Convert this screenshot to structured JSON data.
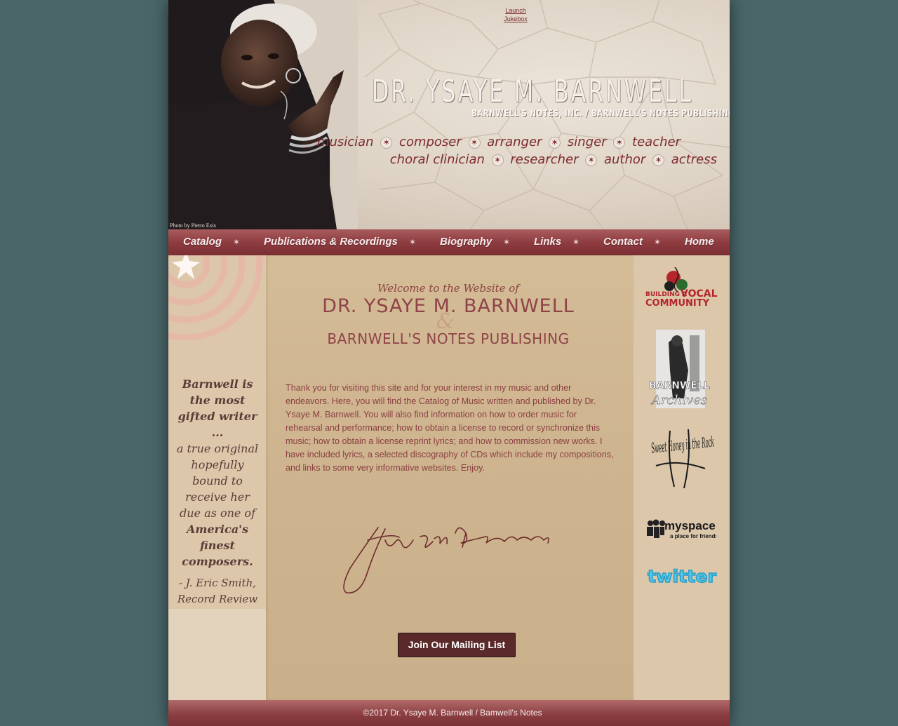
{
  "header": {
    "jukebox_line1": "Launch",
    "jukebox_line2": "Jukebox",
    "title": "DR. YSAYE M. BARNWELL",
    "subtitle": "BARNWELL'S NOTES, INC. / BARNWELL'S NOTES PUBLISHING",
    "photo_credit": "Photo by Pietro Exis",
    "roles_line1": [
      "musician",
      "composer",
      "arranger",
      "singer",
      "teacher"
    ],
    "roles_line2": [
      "choral clinician",
      "researcher",
      "author",
      "actress"
    ],
    "separator_glyph": "✶"
  },
  "nav": {
    "items": [
      "Catalog",
      "Publications & Recordings",
      "Biography",
      "Links",
      "Contact",
      "Home"
    ],
    "separator": "✶"
  },
  "left": {
    "quote_bold1": "Barnwell is the most gifted writer ...",
    "quote_plain": "a true original hopefully bound to receive her due as one of",
    "quote_bold2": "America's finest composers.",
    "attribution": "- J. Eric Smith, Record Review Index"
  },
  "main": {
    "welcome": "Welcome to the Website of",
    "name": "DR. YSAYE M. BARNWELL",
    "ampersand": "&",
    "publishing": "BARNWELL'S NOTES PUBLISHING",
    "intro": "Thank you for visiting this site and for your interest in my music and other endeavors. Here, you will find the Catalog of Music written and published by Dr. Ysaye M. Barnwell. You will also find information on how to order music for rehearsal and performance; how to obtain a license to record or synchronize this music; how to obtain a license reprint lyrics; and how to commission new works. I have included lyrics, a selected discography of CDs which include my compositions, and links to some very informative websites. Enjoy.",
    "signature": "Ysaye M. Barnwell",
    "mailing_button": "Join Our Mailing List"
  },
  "right": {
    "bvc_line1": "BUILDING A",
    "bvc_vocal": "VOCAL",
    "bvc_line2": "COMMUNITY",
    "archives_line1": "BARNWELL",
    "archives_line2": "Archives",
    "sweet_honey": "Sweet Honey in the Rock",
    "myspace": "myspace",
    "myspace_tag": "a place for friends",
    "twitter": "twitter"
  },
  "footer": {
    "text": "©2017 Dr. Ysaye M. Barnwell / Bamwell's Notes"
  },
  "colors": {
    "page_bg": "#4a6669",
    "maroon": "#8f4348",
    "nav_bg": "#8e3c40",
    "button_bg": "#5a2a2b",
    "content_tan": "#cfb690"
  }
}
